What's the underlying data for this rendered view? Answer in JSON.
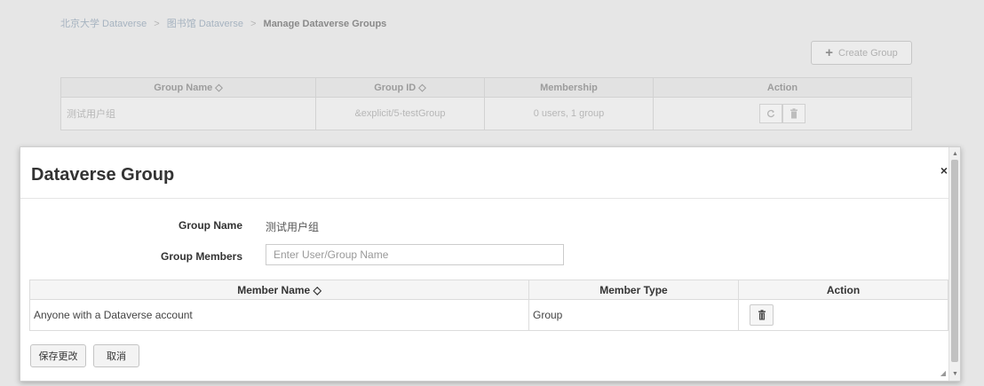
{
  "breadcrumb": {
    "items": [
      "北京大学 Dataverse",
      "图书馆 Dataverse"
    ],
    "separator": ">",
    "current": "Manage Dataverse Groups"
  },
  "create_group": {
    "icon": "plus-icon",
    "label": "Create Group"
  },
  "groups_table": {
    "headers": [
      "Group Name ◇",
      "Group ID ◇",
      "Membership",
      "Action"
    ],
    "rows": [
      {
        "name": "测试用户组",
        "id": "&explicit/5-testGroup",
        "membership": "0 users, 1 group"
      }
    ],
    "row_actions": [
      "edit-icon",
      "trash-icon"
    ]
  },
  "modal": {
    "title": "Dataverse Group",
    "close": "×",
    "group_name_label": "Group Name",
    "group_name_value": "测试用户组",
    "group_members_label": "Group Members",
    "members_input_placeholder": "Enter User/Group Name",
    "members_input_value": "",
    "members_table": {
      "headers": [
        "Member Name ◇",
        "Member Type",
        "Action"
      ],
      "rows": [
        {
          "name": "Anyone with a Dataverse account",
          "type": "Group"
        }
      ]
    },
    "save_label": "保存更改",
    "cancel_label": "取消"
  },
  "colors": {
    "overlay_bg": "#e6e6e6",
    "modal_bg": "#ffffff",
    "breadcrumb_link": "#a6b3c0"
  }
}
